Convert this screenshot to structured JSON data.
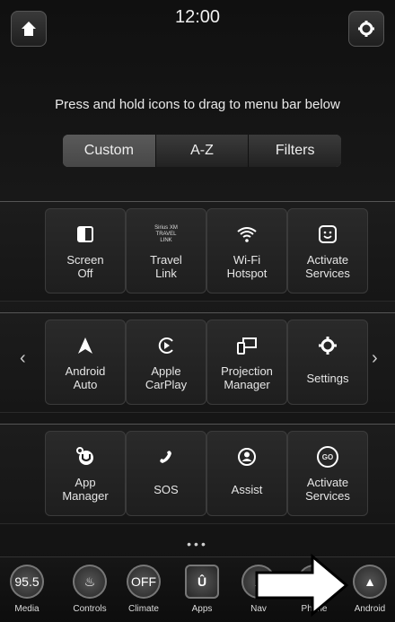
{
  "header": {
    "time": "12:00"
  },
  "hint": "Press and hold icons to drag to menu bar below",
  "tabs": [
    {
      "label": "Custom",
      "active": true
    },
    {
      "label": "A-Z",
      "active": false
    },
    {
      "label": "Filters",
      "active": false
    }
  ],
  "tiles": {
    "screen_off": {
      "line1": "Screen",
      "line2": "Off"
    },
    "travel_link": {
      "line1": "Travel",
      "line2": "Link",
      "icon_text": [
        "Sirius XM",
        "TRAVEL",
        "LINK"
      ]
    },
    "wifi": {
      "line1": "Wi-Fi",
      "line2": "Hotspot"
    },
    "activate_services_1": {
      "line1": "Activate",
      "line2": "Services"
    },
    "android_auto": {
      "line1": "Android",
      "line2": "Auto"
    },
    "apple_carplay": {
      "line1": "Apple",
      "line2": "CarPlay"
    },
    "projection": {
      "line1": "Projection",
      "line2": "Manager"
    },
    "settings": {
      "line1": "Settings"
    },
    "app_manager": {
      "line1": "App",
      "line2": "Manager"
    },
    "sos": {
      "line1": "SOS"
    },
    "assist": {
      "line1": "Assist"
    },
    "activate_services_2": {
      "line1": "Activate",
      "line2": "Services",
      "icon_text": "GO"
    }
  },
  "page_indicator": "•••",
  "dock": {
    "media": {
      "label": "Media",
      "value": "95.5"
    },
    "controls": {
      "label": "Controls"
    },
    "climate": {
      "label": "Climate",
      "value": "OFF"
    },
    "apps": {
      "label": "Apps"
    },
    "nav": {
      "label": "Nav"
    },
    "phone": {
      "label": "Phone"
    },
    "android": {
      "label": "Android"
    }
  },
  "icons": {
    "home": "home-icon",
    "gear": "gear-icon",
    "screen_off": "half-square-icon",
    "wifi": "wifi-icon",
    "smiley": "smiley-icon",
    "android_auto": "android-auto-icon",
    "carplay": "carplay-icon",
    "projection": "projection-icon",
    "settings": "gear-icon",
    "app_manager": "uconnect-gear-icon",
    "sos": "phone-icon",
    "assist": "person-icon",
    "go": "go-icon"
  }
}
